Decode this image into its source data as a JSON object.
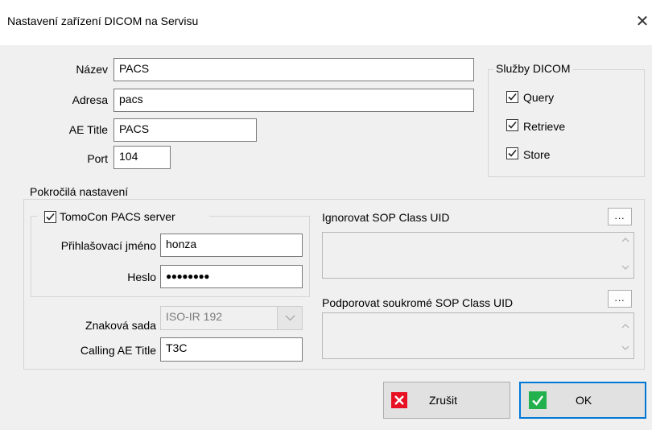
{
  "window": {
    "title": "Nastavení zařízení DICOM na Servisu",
    "close_glyph": "✕"
  },
  "form": {
    "name_label": "Název",
    "name_value": "PACS",
    "address_label": "Adresa",
    "address_value": "pacs",
    "ae_title_label": "AE Title",
    "ae_title_value": "PACS",
    "port_label": "Port",
    "port_value": "104"
  },
  "services": {
    "legend": "Služby DICOM",
    "query": {
      "label": "Query",
      "checked": true
    },
    "retrieve": {
      "label": "Retrieve",
      "checked": true
    },
    "store": {
      "label": "Store",
      "checked": true
    }
  },
  "advanced": {
    "legend": "Pokročilá nastavení",
    "tomocon": {
      "label": "TomoCon PACS server",
      "checked": true
    },
    "login_label": "Přihlašovací jméno",
    "login_value": "honza",
    "password_label": "Heslo",
    "password_value": "●●●●●●●●",
    "charset_label": "Znaková sada",
    "charset_value": "ISO-IR 192",
    "calling_ae_label": "Calling AE Title",
    "calling_ae_value": "T3C",
    "ignore_sop_label": "Ignorovat SOP Class UID",
    "private_sop_label": "Podporovat soukromé SOP Class UID",
    "browse_label": "..."
  },
  "buttons": {
    "cancel_label": "Zrušit",
    "ok_label": "OK"
  },
  "colors": {
    "accent": "#0078d7",
    "cancel_icon": "#e81123",
    "ok_icon": "#22b14c"
  }
}
